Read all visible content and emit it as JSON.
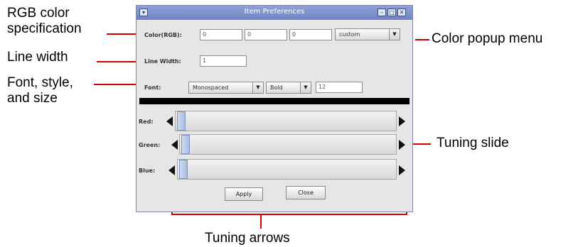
{
  "window": {
    "title": "Item Preferences",
    "menu_icon": "▾",
    "minimize_icon": "–",
    "maximize_icon": "□",
    "close_icon": "✕"
  },
  "color_row": {
    "label": "Color(RGB):",
    "r_value": "0",
    "g_value": "0",
    "b_value": "0",
    "preset_value": "custom"
  },
  "line_width": {
    "label": "Line Width:",
    "value": "1"
  },
  "font_row": {
    "label": "Font:",
    "family": "Monospaced",
    "style": "Bold",
    "size": "12"
  },
  "sliders": [
    {
      "label": "Red:",
      "level": 0
    },
    {
      "label": "Green:",
      "level": 0
    },
    {
      "label": "Blue:",
      "level": 0
    }
  ],
  "buttons": {
    "apply": "Apply",
    "close": "Close"
  },
  "annotations": {
    "rgb_line1": "RGB color",
    "rgb_line2": "specification",
    "line_width": "Line width",
    "font_line1": "Font, style,",
    "font_line2": "and size",
    "color_popup": "Color popup menu",
    "tuning_slide": "Tuning slide",
    "tuning_arrows": "Tuning arrows"
  },
  "colors": {
    "callout_line": "#d40000",
    "title_bar": "#7b8fcc",
    "dialog_bg": "#e6e6e6",
    "thumb": "#b5c8e8"
  }
}
